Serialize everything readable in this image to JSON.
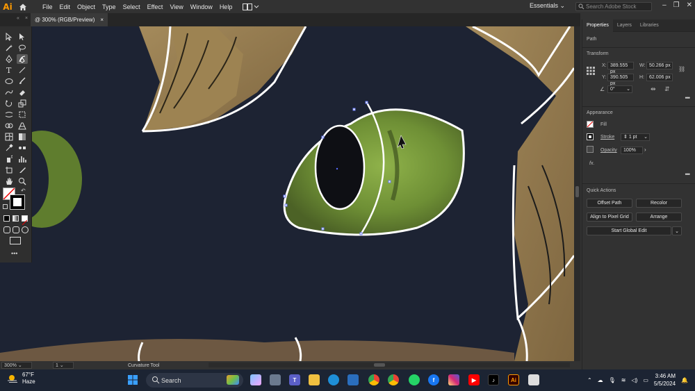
{
  "app": {
    "logo": "Ai",
    "brand_color": "#ff9a00"
  },
  "menu": [
    "File",
    "Edit",
    "Object",
    "Type",
    "Select",
    "Effect",
    "View",
    "Window",
    "Help"
  ],
  "workspace": {
    "label": "Essentials",
    "search_placeholder": "Search Adobe Stock"
  },
  "document_tab": {
    "title": "@ 300% (RGB/Preview)",
    "close": "×"
  },
  "status": {
    "zoom": "300%",
    "page": "1",
    "tool_name": "Curvature Tool"
  },
  "panel": {
    "tabs": [
      "Properties",
      "Layers",
      "Libraries"
    ],
    "selection_type": "Path",
    "transform": {
      "title": "Transform",
      "x_label": "X:",
      "x_value": "389.555 px",
      "y_label": "Y:",
      "y_value": "390.505 px",
      "w_label": "W:",
      "w_value": "50.266 px",
      "h_label": "H:",
      "h_value": "62.006 px",
      "rotate_value": "0°"
    },
    "appearance": {
      "title": "Appearance",
      "fill_label": "Fill",
      "stroke_label": "Stroke",
      "stroke_value": "1 pt",
      "opacity_label": "Opacity",
      "opacity_value": "100%",
      "fx_label": "fx."
    },
    "quick_actions": {
      "title": "Quick Actions",
      "offset_path": "Offset Path",
      "recolor": "Recolor",
      "align_pixel": "Align to Pixel Grid",
      "arrange": "Arrange",
      "global_edit": "Start Global Edit"
    }
  },
  "taskbar": {
    "temperature": "67°F",
    "condition": "Haze",
    "search_label": "Search",
    "time": "3:46 AM",
    "date": "5/5/2024"
  }
}
